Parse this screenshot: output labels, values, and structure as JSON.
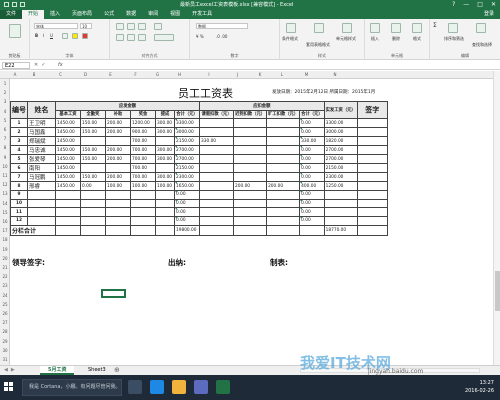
{
  "window": {
    "title": "最新员工excel工资表模板.xlsx [兼容模式] - Excel",
    "controls": [
      "?",
      "—",
      "□",
      "✕"
    ]
  },
  "ribbon_tabs": [
    "文件",
    "开始",
    "插入",
    "页面布局",
    "公式",
    "数据",
    "审阅",
    "视图",
    "开发工具"
  ],
  "ribbon_user": "登录",
  "ribbon": {
    "font_name": "宋体",
    "font_size": "10",
    "number_format": "数据",
    "groups": [
      "剪贴板",
      "字体",
      "对齐方式",
      "数字",
      "样式",
      "单元格",
      "编辑"
    ],
    "style_buttons": [
      "条件格式",
      "套用表格格式",
      "单元格样式"
    ],
    "cell_buttons": [
      "插入",
      "删除",
      "格式"
    ],
    "edit_buttons": [
      "排序和筛选",
      "查找和选择"
    ]
  },
  "formula_bar": {
    "name_box": "E22",
    "fx": "fx",
    "content": ""
  },
  "columns": [
    "A",
    "B",
    "C",
    "D",
    "E",
    "F",
    "G",
    "H",
    "I",
    "J",
    "K",
    "L",
    "M",
    "N"
  ],
  "rows": [
    "1",
    "2",
    "3",
    "4",
    "5",
    "6",
    "7",
    "8",
    "9",
    "10",
    "11",
    "12",
    "13",
    "14",
    "15",
    "16",
    "17",
    "18",
    "19",
    "20",
    "21",
    "22",
    "23",
    "24",
    "25",
    "26",
    "27",
    "28",
    "29",
    "30",
    "31"
  ],
  "payroll": {
    "title": "员工工资表",
    "meta": "发放日期：2015年2月12日  所属日期：2015年1月",
    "headers": {
      "no": "编号",
      "name": "姓名",
      "payable_group": "应发金额",
      "deduct_group": "应扣金额",
      "actual": "实发工资（元）",
      "sign": "签字",
      "payable": [
        "基本工资",
        "全勤奖",
        "补助",
        "奖金",
        "提成",
        "合计（元）"
      ],
      "deduct": [
        "请假扣款（元）",
        "迟到扣款（元）",
        "旷工扣款（元）",
        "合计（元）"
      ]
    },
    "rows": [
      {
        "no": "1",
        "name": "王卫明",
        "v": [
          "1450.00",
          "150.00",
          "200.00",
          "1200.00",
          "300.00",
          "3300.00",
          "",
          "",
          "",
          "0.00",
          "3300.00"
        ]
      },
      {
        "no": "2",
        "name": "马国鑫",
        "v": [
          "1450.00",
          "150.00",
          "200.00",
          "900.00",
          "300.00",
          "3000.00",
          "",
          "",
          "",
          "0.00",
          "3000.00"
        ]
      },
      {
        "no": "3",
        "name": "郑瑞斌",
        "v": [
          "1450.00",
          "",
          "",
          "700.00",
          "",
          "2150.00",
          "330.00",
          "",
          "",
          "330.00",
          "1820.00"
        ]
      },
      {
        "no": "4",
        "name": "马忠诚",
        "v": [
          "1450.00",
          "150.00",
          "200.00",
          "700.00",
          "300.00",
          "2700.00",
          "",
          "",
          "",
          "0.00",
          "2700.00"
        ]
      },
      {
        "no": "5",
        "name": "张爱琴",
        "v": [
          "1450.00",
          "150.00",
          "200.00",
          "700.00",
          "300.00",
          "2700.00",
          "",
          "",
          "",
          "0.00",
          "2700.00"
        ]
      },
      {
        "no": "6",
        "name": "南阳",
        "v": [
          "1450.00",
          "",
          "",
          "700.00",
          "",
          "2150.00",
          "",
          "",
          "",
          "0.00",
          "2150.00"
        ]
      },
      {
        "no": "7",
        "name": "马冠鹏",
        "v": [
          "1450.00",
          "150.00",
          "200.00",
          "700.00",
          "300.00",
          "2300.00",
          "",
          "",
          "",
          "0.00",
          "2300.00"
        ]
      },
      {
        "no": "8",
        "name": "邢睿",
        "v": [
          "1450.00",
          "0.00",
          "100.00",
          "100.00",
          "100.00",
          "1650.00",
          "",
          "200.00",
          "200.00",
          "400.00",
          "1250.00"
        ]
      },
      {
        "no": "9",
        "name": "",
        "v": [
          "",
          "",
          "",
          "",
          "",
          "0.00",
          "",
          "",
          "",
          "0.00",
          ""
        ]
      },
      {
        "no": "10",
        "name": "",
        "v": [
          "",
          "",
          "",
          "",
          "",
          "0.00",
          "",
          "",
          "",
          "0.00",
          ""
        ]
      },
      {
        "no": "11",
        "name": "",
        "v": [
          "",
          "",
          "",
          "",
          "",
          "0.00",
          "",
          "",
          "",
          "0.00",
          ""
        ]
      },
      {
        "no": "12",
        "name": "",
        "v": [
          "",
          "",
          "",
          "",
          "",
          "0.00",
          "",
          "",
          "",
          "0.00",
          ""
        ]
      }
    ],
    "subtotal_label": "分栏合计",
    "subtotal_values": [
      "",
      "",
      "",
      "",
      "",
      "19800.00",
      "",
      "",
      "",
      "",
      "18770.00"
    ]
  },
  "signatures": [
    "领导签字:",
    "出纳:",
    "制表:"
  ],
  "sheet_tabs": [
    "5月工资",
    "Sheet3"
  ],
  "taskbar": {
    "search": "我是 Cortana，小娜。有问题尽管问我。",
    "time": "13:27",
    "date": "2016-02-26"
  },
  "watermark": {
    "main": "我爱IT技术网",
    "url": "jingyan.baidu.com"
  },
  "colors": {
    "excel_green": "#217346",
    "taskbar": "#1e2a38"
  }
}
